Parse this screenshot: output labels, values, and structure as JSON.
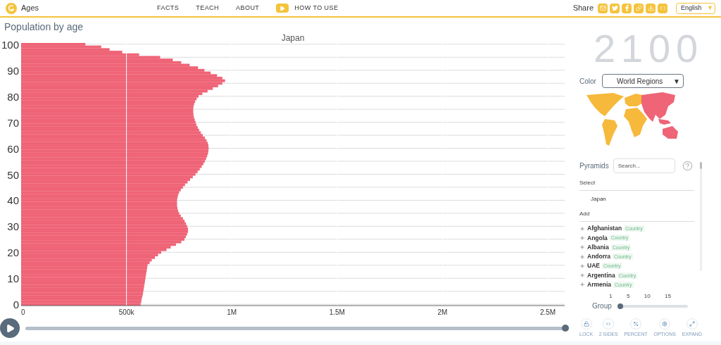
{
  "header": {
    "app_name": "Ages",
    "nav": [
      {
        "label": "FACTS",
        "kind": "link"
      },
      {
        "label": "TEACH",
        "kind": "link"
      },
      {
        "label": "ABOUT",
        "kind": "link"
      },
      {
        "label": "HOW TO USE",
        "kind": "video"
      }
    ],
    "share_label": "Share",
    "language": "English",
    "language_caret": "▼"
  },
  "page_title": "Population by age",
  "chart_data": {
    "type": "bar",
    "orientation": "horizontal",
    "title": "Japan",
    "grid": true,
    "x": [
      100,
      99,
      98,
      97,
      96,
      95,
      94,
      93,
      92,
      91,
      90,
      89,
      88,
      87,
      86,
      85,
      84,
      83,
      82,
      81,
      80,
      79,
      78,
      77,
      76,
      75,
      74,
      73,
      72,
      71,
      70,
      69,
      68,
      67,
      66,
      65,
      64,
      63,
      62,
      61,
      60,
      59,
      58,
      57,
      56,
      55,
      54,
      53,
      52,
      51,
      50,
      49,
      48,
      47,
      46,
      45,
      44,
      43,
      42,
      41,
      40,
      39,
      38,
      37,
      36,
      35,
      34,
      33,
      32,
      31,
      30,
      29,
      28,
      27,
      26,
      25,
      24,
      23,
      22,
      21,
      20,
      19,
      18,
      17,
      16,
      15,
      14,
      13,
      12,
      11,
      10,
      9,
      8,
      7,
      6,
      5,
      4,
      3,
      2,
      1,
      0
    ],
    "series": [
      {
        "color": "#ef6477",
        "values": [
          305000,
          380000,
          420000,
          480000,
          560000,
          660000,
          720000,
          760000,
          800000,
          840000,
          870000,
          900000,
          930000,
          955000,
          968000,
          955000,
          935000,
          910000,
          885000,
          860000,
          842000,
          833000,
          826000,
          821000,
          818000,
          817000,
          817000,
          818000,
          820000,
          824000,
          828000,
          832000,
          838000,
          845000,
          853000,
          862000,
          872000,
          880000,
          886000,
          889000,
          890000,
          889000,
          887000,
          883000,
          878000,
          872000,
          865000,
          857000,
          848000,
          838000,
          828000,
          815000,
          802000,
          790000,
          778000,
          768000,
          758000,
          750000,
          745000,
          742000,
          740000,
          740000,
          740000,
          742000,
          745000,
          750000,
          758000,
          768000,
          776000,
          782000,
          788000,
          792000,
          792000,
          788000,
          782000,
          775000,
          760000,
          735000,
          710000,
          690000,
          665000,
          650000,
          635000,
          620000,
          610000,
          600000,
          598000,
          596000,
          594000,
          592000,
          590000,
          588000,
          586000,
          584000,
          582000,
          580000,
          578000,
          575000,
          572000,
          570000,
          567000
        ]
      }
    ],
    "xlim": [
      0,
      2580000
    ],
    "ylim": [
      -0.5,
      100.5
    ],
    "xticks": [
      {
        "value": 0,
        "label": "0"
      },
      {
        "value": 500000,
        "label": "500k"
      },
      {
        "value": 1000000,
        "label": "1M"
      },
      {
        "value": 1500000,
        "label": "1.5M"
      },
      {
        "value": 2000000,
        "label": "2M"
      },
      {
        "value": 2500000,
        "label": "2.5M"
      }
    ],
    "yticks": [
      0,
      10,
      20,
      30,
      40,
      50,
      60,
      70,
      80,
      90,
      100
    ]
  },
  "timeline": {
    "level": 1
  },
  "sidebar": {
    "year": "2100",
    "color_label": "Color",
    "color_value": "World Regions",
    "color_caret": "▼",
    "pyramids_label": "Pyramids",
    "search": {
      "placeholder": "Search..."
    },
    "select_label": "Select",
    "selected": [
      "Japan"
    ],
    "add_label": "Add",
    "countries": [
      {
        "name": "Afghanistan",
        "tag": "Country"
      },
      {
        "name": "Angola",
        "tag": "Country"
      },
      {
        "name": "Albania",
        "tag": "Country"
      },
      {
        "name": "Andorra",
        "tag": "Country"
      },
      {
        "name": "UAE",
        "tag": "Country"
      },
      {
        "name": "Argentina",
        "tag": "Country"
      },
      {
        "name": "Armenia",
        "tag": "Country"
      }
    ],
    "group": {
      "label": "Group",
      "ticks": [
        "1",
        "5",
        "10",
        "15"
      ],
      "level": 0
    },
    "tools": [
      {
        "label": "LOCK",
        "kind": "lock"
      },
      {
        "label": "2 SIDES",
        "kind": "sides"
      },
      {
        "label": "PERCENT",
        "kind": "percent"
      },
      {
        "label": "OPTIONS",
        "kind": "options"
      },
      {
        "label": "EXPAND",
        "kind": "expand"
      }
    ]
  }
}
